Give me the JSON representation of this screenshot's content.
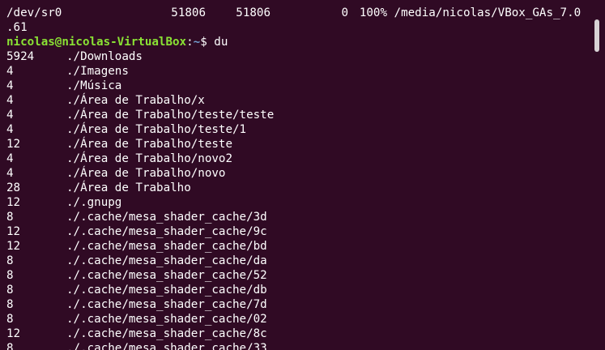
{
  "terminal": {
    "df_line": {
      "filesystem": "/dev/sr0",
      "size": "51806",
      "used": "51806",
      "avail": "0",
      "use_pct": "100%",
      "mount": "/media/nicolas/VBox_GAs_7.0"
    },
    "df_wrap": ".61",
    "prompt": {
      "user_host": "nicolas@nicolas-VirtualBox",
      "sep": ":",
      "path": "~",
      "symbol": "$ ",
      "command": "du"
    },
    "du_rows": [
      {
        "size": "5924",
        "path": "./Downloads"
      },
      {
        "size": "4",
        "path": "./Imagens"
      },
      {
        "size": "4",
        "path": "./Música"
      },
      {
        "size": "4",
        "path": "./Área de Trabalho/x"
      },
      {
        "size": "4",
        "path": "./Área de Trabalho/teste/teste"
      },
      {
        "size": "4",
        "path": "./Área de Trabalho/teste/1"
      },
      {
        "size": "12",
        "path": "./Área de Trabalho/teste"
      },
      {
        "size": "4",
        "path": "./Área de Trabalho/novo2"
      },
      {
        "size": "4",
        "path": "./Área de Trabalho/novo"
      },
      {
        "size": "28",
        "path": "./Área de Trabalho"
      },
      {
        "size": "12",
        "path": "./.gnupg"
      },
      {
        "size": "8",
        "path": "./.cache/mesa_shader_cache/3d"
      },
      {
        "size": "12",
        "path": "./.cache/mesa_shader_cache/9c"
      },
      {
        "size": "12",
        "path": "./.cache/mesa_shader_cache/bd"
      },
      {
        "size": "8",
        "path": "./.cache/mesa_shader_cache/da"
      },
      {
        "size": "8",
        "path": "./.cache/mesa_shader_cache/52"
      },
      {
        "size": "8",
        "path": "./.cache/mesa_shader_cache/db"
      },
      {
        "size": "8",
        "path": "./.cache/mesa_shader_cache/7d"
      },
      {
        "size": "8",
        "path": "./.cache/mesa_shader_cache/02"
      },
      {
        "size": "12",
        "path": "./.cache/mesa_shader_cache/8c"
      },
      {
        "size": "8",
        "path": "./.cache/mesa_shader_cache/33"
      }
    ]
  },
  "colors": {
    "background": "#300a24",
    "text": "#ffffff",
    "prompt_user": "#8ae234",
    "prompt_path": "#729fcf"
  }
}
